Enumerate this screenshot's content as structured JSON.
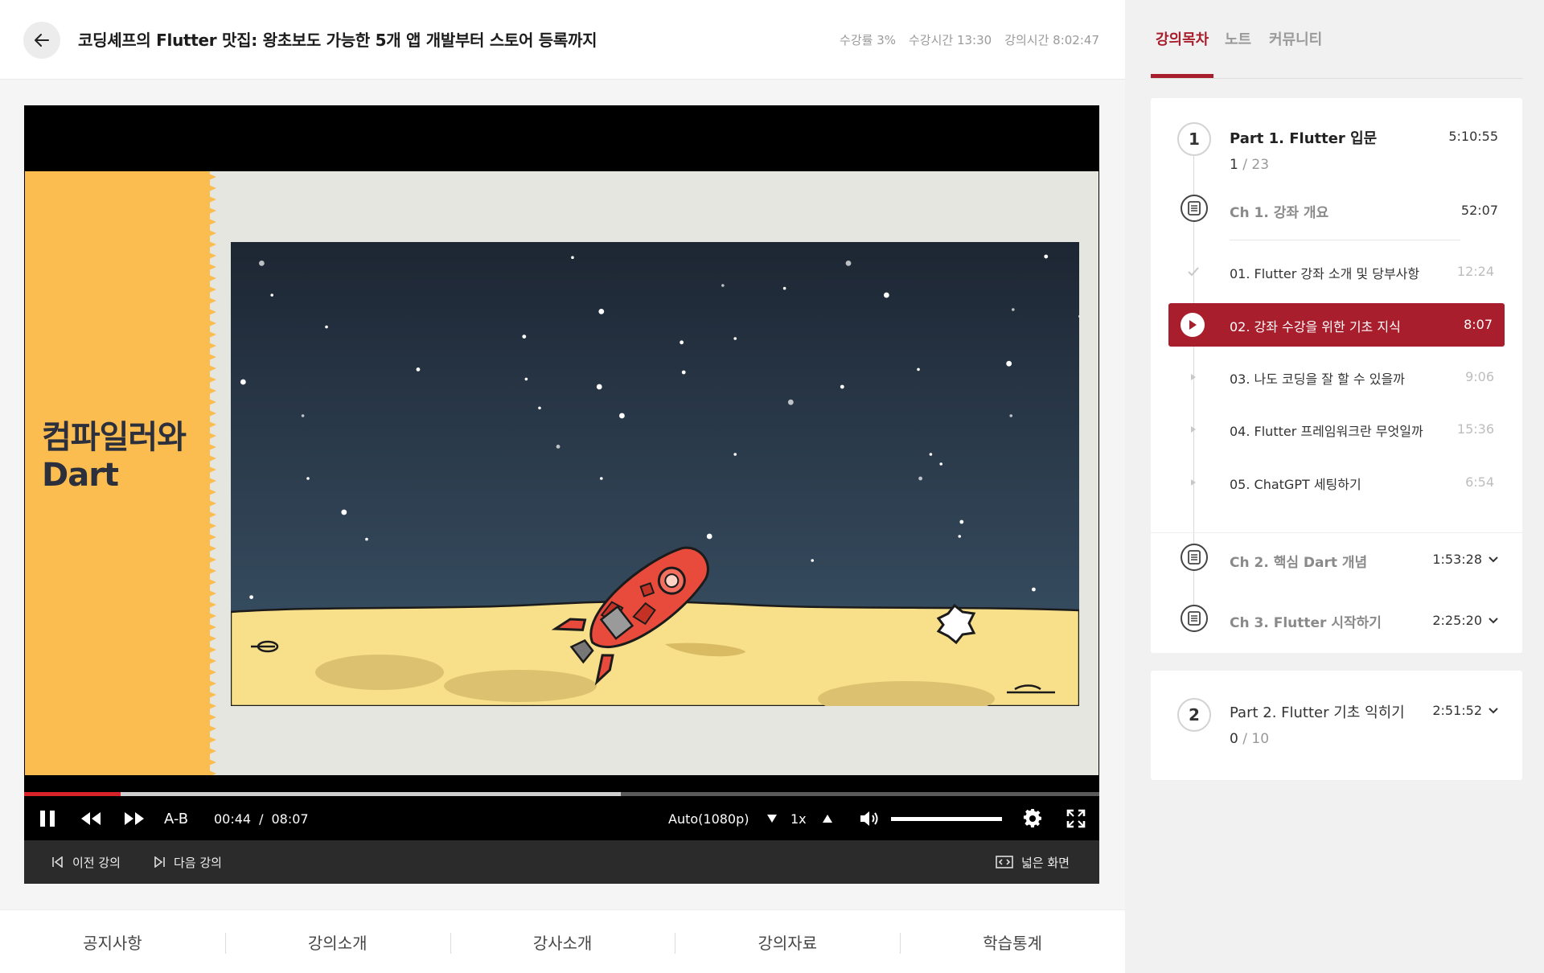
{
  "header": {
    "title": "코딩셰프의 Flutter 맛집: 왕초보도 가능한 5개 앱 개발부터 스토어 등록까지",
    "stats": [
      "수강률 3%",
      "수강시간 13:30",
      "강의시간 8:02:47"
    ]
  },
  "slide": {
    "line1": "컴파일러와",
    "line2": "Dart"
  },
  "player": {
    "progress_fraction": 0.09,
    "buffered_fraction": 0.555,
    "ab_label": "A-B",
    "current_time": "00:44",
    "separator": "/",
    "total_time": "08:07",
    "quality": "Auto(1080p)",
    "speed": "1x",
    "volume_fraction": 1.0,
    "prev_label": "이전 강의",
    "next_label": "다음 강의",
    "wide_label": "넓은 화면"
  },
  "bottom_tabs": [
    "공지사항",
    "강의소개",
    "강사소개",
    "강의자료",
    "학습통계"
  ],
  "sidebar": {
    "tabs": [
      "강의목차",
      "노트",
      "커뮤니티"
    ],
    "part1": {
      "number": "1",
      "title": "Part 1. Flutter 입문",
      "duration": "5:10:55",
      "done": "1",
      "slash": "/",
      "total": "23"
    },
    "ch1": {
      "title": "Ch 1. 강좌 개요",
      "duration": "52:07"
    },
    "lessons": [
      {
        "title": "01. Flutter 강좌 소개 및 당부사항",
        "duration": "12:24",
        "state": "done"
      },
      {
        "title": "02. 강좌 수강을 위한 기초 지식",
        "duration": "8:07",
        "state": "playing"
      },
      {
        "title": "03. 나도 코딩을 잘 할 수 있을까",
        "duration": "9:06",
        "state": "todo"
      },
      {
        "title": "04. Flutter 프레임워크란 무엇일까",
        "duration": "15:36",
        "state": "todo"
      },
      {
        "title": "05. ChatGPT 세팅하기",
        "duration": "6:54",
        "state": "todo"
      }
    ],
    "ch2": {
      "title": "Ch 2. 핵심 Dart 개념",
      "duration": "1:53:28"
    },
    "ch3": {
      "title": "Ch 3. Flutter 시작하기",
      "duration": "2:25:20"
    },
    "part2": {
      "number": "2",
      "title": "Part 2. Flutter 기초 익히기",
      "duration": "2:51:52",
      "done": "0",
      "slash": "/",
      "total": "10"
    }
  },
  "colors": {
    "accent": "#a81e2d",
    "progress": "#d8232a",
    "slide_yellow": "#fbbd4f"
  }
}
